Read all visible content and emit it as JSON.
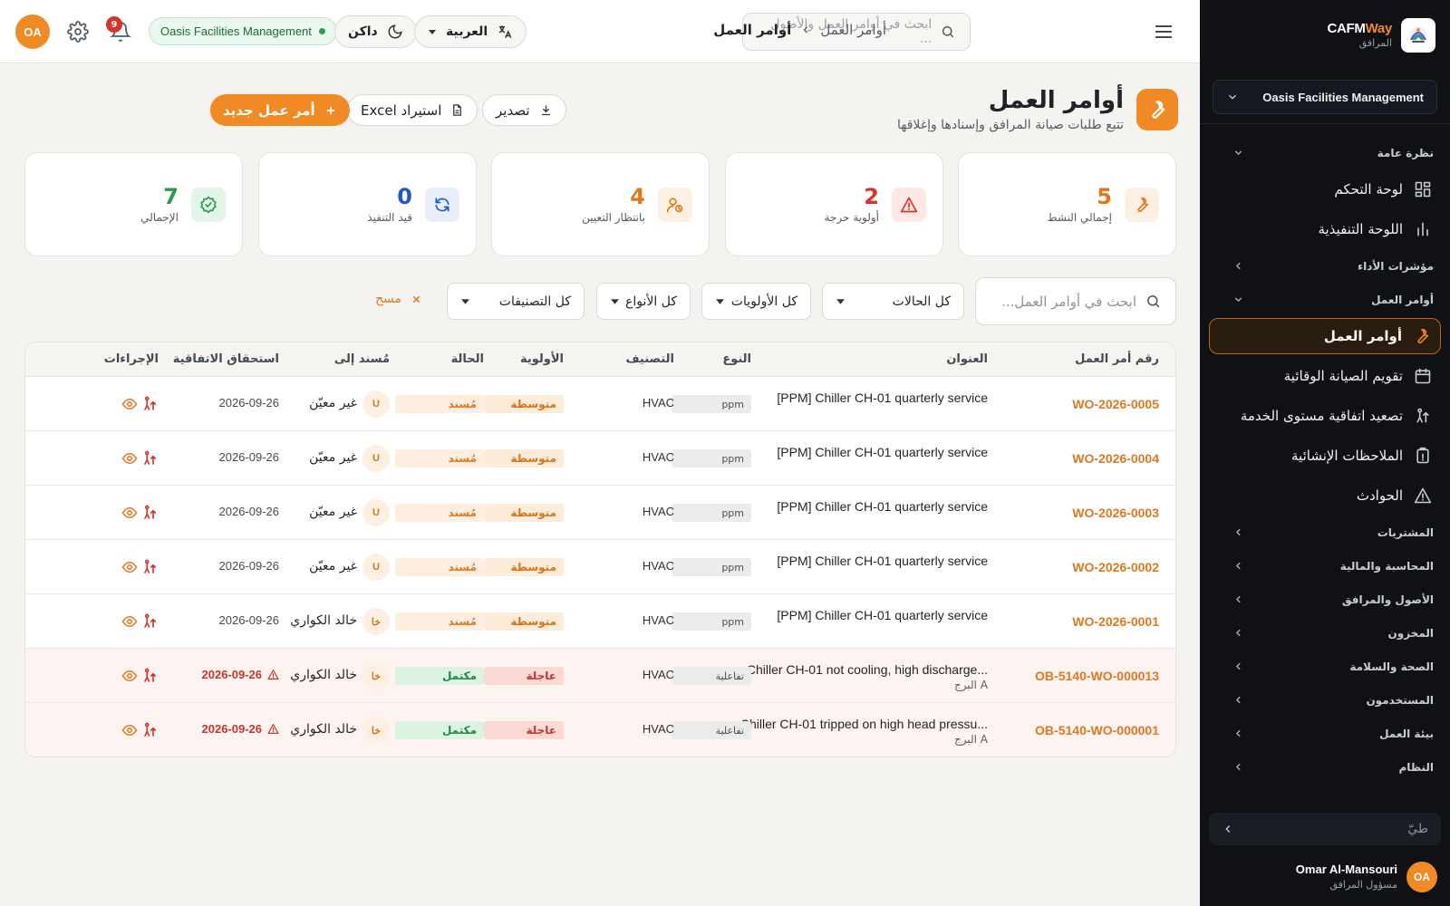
{
  "sidebar": {
    "brand_main": "CAFM",
    "brand_accent": "Way",
    "brand_sub": "المرافق",
    "org_select": "Oasis Facilities Management",
    "sections": [
      {
        "label": "نظرة عامة",
        "expanded": true,
        "items": [
          {
            "label": "لوحة التحكم",
            "icon": "dashboard-icon"
          },
          {
            "label": "اللوحة التنفيذية",
            "icon": "bar-chart-icon"
          }
        ]
      },
      {
        "label": "مؤشرات الأداء",
        "expanded": false,
        "items": []
      },
      {
        "label": "أوامر العمل",
        "expanded": true,
        "items": [
          {
            "label": "أوامر العمل",
            "icon": "wrench-icon",
            "active": true
          },
          {
            "label": "تقويم الصيانة الوقائية",
            "icon": "calendar-icon"
          },
          {
            "label": "تصعيد اتفاقية مستوى الخدمة",
            "icon": "escalation-icon"
          },
          {
            "label": "الملاحظات الإنشائية",
            "icon": "clipboard-icon"
          },
          {
            "label": "الحوادث",
            "icon": "warning-icon"
          }
        ]
      },
      {
        "label": "المشتريات",
        "expanded": false,
        "items": []
      },
      {
        "label": "المحاسبة والمالية",
        "expanded": false,
        "items": []
      },
      {
        "label": "الأصول والمرافق",
        "expanded": false,
        "items": []
      },
      {
        "label": "المخزون",
        "expanded": false,
        "items": []
      },
      {
        "label": "الصحة والسلامة",
        "expanded": false,
        "items": []
      },
      {
        "label": "المستخدمون",
        "expanded": false,
        "items": []
      },
      {
        "label": "بيئة العمل",
        "expanded": false,
        "items": []
      },
      {
        "label": "النظام",
        "expanded": false,
        "items": []
      }
    ],
    "collapse_label": "طيّ",
    "user": {
      "initials": "OA",
      "name": "Omar Al-Mansouri",
      "role": "مسؤول المرافق"
    }
  },
  "topbar": {
    "avatar_initials": "OA",
    "notification_count": "9",
    "org_pill": "Oasis Facilities Management",
    "theme_label": "داكن",
    "language_label": "العربية",
    "search_placeholder": "ابحث في أوامر العمل والأصول ...",
    "breadcrumb_parent": "أوامر العمل",
    "breadcrumb_current": "أوامر العمل"
  },
  "page": {
    "title": "أوامر العمل",
    "subtitle": "تتبع طلبات صيانة المرافق وإسنادها وإغلاقها",
    "export_label": "تصدير",
    "import_label": "استيراد Excel",
    "new_label": "أمر عمل جديد"
  },
  "kpis": [
    {
      "value": "5",
      "label": "إجمالي النشط",
      "color": "#e07820",
      "bg": "#fdf0e2",
      "icon": "wrench-icon"
    },
    {
      "value": "2",
      "label": "أولوية حرجة",
      "color": "#d6342b",
      "bg": "#fde8e6",
      "icon": "warning-icon"
    },
    {
      "value": "4",
      "label": "بانتظار التعيين",
      "color": "#e07820",
      "bg": "#fdf0e2",
      "icon": "user-clock-icon"
    },
    {
      "value": "0",
      "label": "قيد التنفيذ",
      "color": "#2456c9",
      "bg": "#e6eefc",
      "icon": "refresh-icon"
    },
    {
      "value": "7",
      "label": "الإجمالي",
      "color": "#2a9a4d",
      "bg": "#e3f5e9",
      "icon": "check-badge-icon"
    }
  ],
  "filters": {
    "search_placeholder": "ابحث في أوامر العمل...",
    "status": "كل الحالات",
    "priority": "كل الأولويات",
    "type": "كل الأنواع",
    "category": "كل التصنيفات",
    "clear": "مسح"
  },
  "table": {
    "headers": {
      "number": "رقم أمر العمل",
      "title": "العنوان",
      "type": "النوع",
      "category": "التصنيف",
      "priority": "الأولوية",
      "status": "الحالة",
      "assigned": "مُسند إلى",
      "sla": "استحقاق الاتفاقية",
      "actions": "الإجراءات"
    },
    "rows": [
      {
        "number": "WO-2026-0005",
        "title": "[PPM] Chiller CH-01 quarterly service",
        "location": "",
        "type": "ppm",
        "category": "HVAC",
        "priority": "متوسطة",
        "priority_kind": "medium",
        "status": "مُسند",
        "status_kind": "assigned",
        "assignee_initials": "U",
        "assignee": "غير معيّن",
        "due": "2026-09-26",
        "overdue": false
      },
      {
        "number": "WO-2026-0004",
        "title": "[PPM] Chiller CH-01 quarterly service",
        "location": "",
        "type": "ppm",
        "category": "HVAC",
        "priority": "متوسطة",
        "priority_kind": "medium",
        "status": "مُسند",
        "status_kind": "assigned",
        "assignee_initials": "U",
        "assignee": "غير معيّن",
        "due": "2026-09-26",
        "overdue": false
      },
      {
        "number": "WO-2026-0003",
        "title": "[PPM] Chiller CH-01 quarterly service",
        "location": "",
        "type": "ppm",
        "category": "HVAC",
        "priority": "متوسطة",
        "priority_kind": "medium",
        "status": "مُسند",
        "status_kind": "assigned",
        "assignee_initials": "U",
        "assignee": "غير معيّن",
        "due": "2026-09-26",
        "overdue": false
      },
      {
        "number": "WO-2026-0002",
        "title": "[PPM] Chiller CH-01 quarterly service",
        "location": "",
        "type": "ppm",
        "category": "HVAC",
        "priority": "متوسطة",
        "priority_kind": "medium",
        "status": "مُسند",
        "status_kind": "assigned",
        "assignee_initials": "U",
        "assignee": "غير معيّن",
        "due": "2026-09-26",
        "overdue": false
      },
      {
        "number": "WO-2026-0001",
        "title": "[PPM] Chiller CH-01 quarterly service",
        "location": "",
        "type": "ppm",
        "category": "HVAC",
        "priority": "متوسطة",
        "priority_kind": "medium",
        "status": "مُسند",
        "status_kind": "assigned",
        "assignee_initials": "خا",
        "assignee": "خالد الكواري",
        "due": "2026-09-26",
        "overdue": false
      },
      {
        "number": "OB-5140-WO-000013",
        "title": "Chiller CH-01 not cooling, high discharge...",
        "location": "البرج A",
        "type": "تفاعلية",
        "category": "HVAC",
        "priority": "عاجلة",
        "priority_kind": "urgent",
        "status": "مكتمل",
        "status_kind": "completed",
        "assignee_initials": "خا",
        "assignee": "خالد الكواري",
        "due": "2026-09-26",
        "overdue": true
      },
      {
        "number": "OB-5140-WO-000001",
        "title": "Chiller CH-01 tripped on high head pressu...",
        "location": "البرج A",
        "type": "تفاعلية",
        "category": "HVAC",
        "priority": "عاجلة",
        "priority_kind": "urgent",
        "status": "مكتمل",
        "status_kind": "completed",
        "assignee_initials": "خا",
        "assignee": "خالد الكواري",
        "due": "2026-09-26",
        "overdue": true
      }
    ]
  },
  "colors": {
    "accent": "#f08a24",
    "sidebar_bg": "#0f1115",
    "page_bg": "#f5f3ef",
    "medium_bg": "#fdecd9",
    "medium_fg": "#d9731a",
    "assigned_bg": "#fdeee0",
    "assigned_fg": "#e07820",
    "urgent_bg": "#fbdad6",
    "urgent_fg": "#c0392b",
    "completed_bg": "#dcf3e2",
    "completed_fg": "#1f8a45"
  }
}
